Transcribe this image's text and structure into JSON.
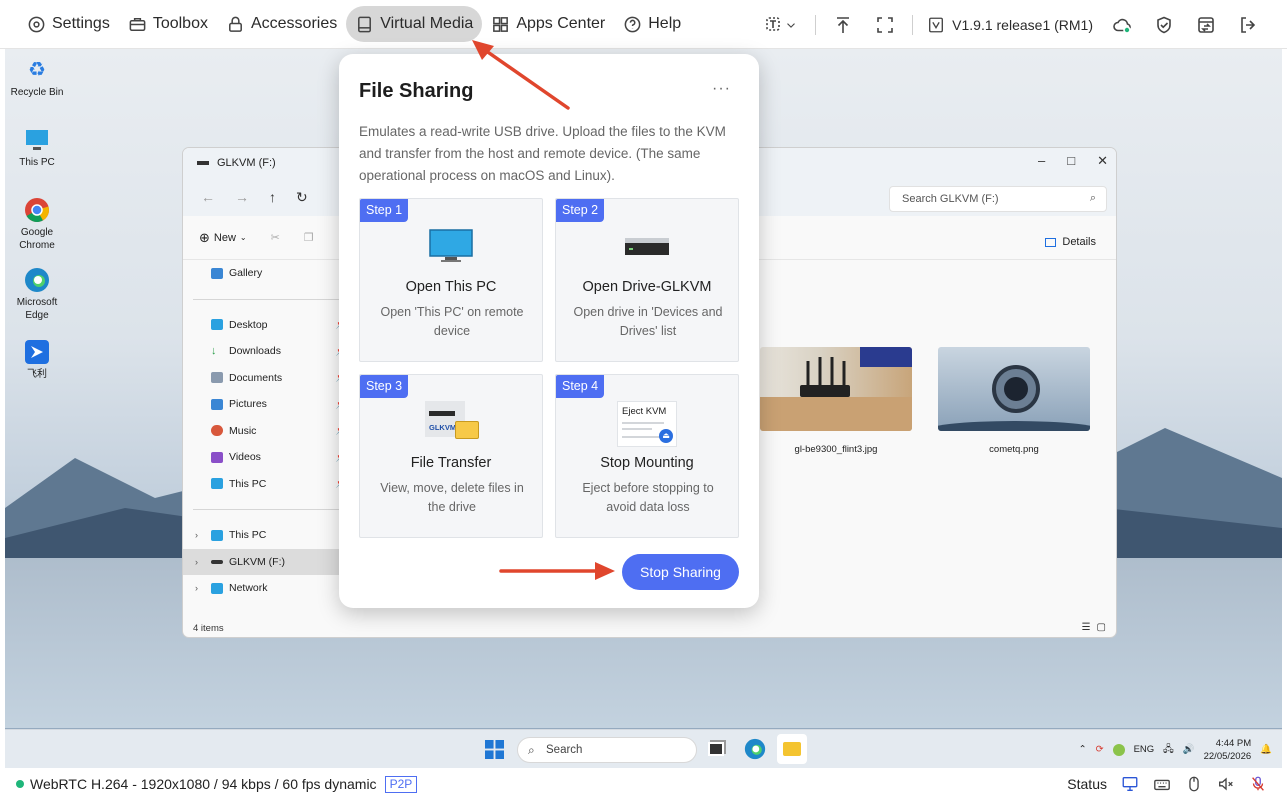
{
  "topbar": {
    "settings": "Settings",
    "toolbox": "Toolbox",
    "accessories": "Accessories",
    "virtual_media": "Virtual Media",
    "apps_center": "Apps Center",
    "help": "Help",
    "version": "V1.9.1 release1 (RM1)"
  },
  "desktop": {
    "icons": [
      "Recycle Bin",
      "This PC",
      "Google Chrome",
      "Microsoft Edge",
      "飞利"
    ]
  },
  "explorer": {
    "tab_title": "GLKVM (F:)",
    "search_placeholder": "Search GLKVM (F:)",
    "new_label": "New",
    "details_label": "Details",
    "sidebar": [
      "Gallery",
      "Desktop",
      "Downloads",
      "Documents",
      "Pictures",
      "Music",
      "Videos",
      "This PC"
    ],
    "tree": [
      "This PC",
      "GLKVM (F:)",
      "Network"
    ],
    "status": "4 items",
    "files": [
      "gl-be9300_flint3.jpg",
      "cometq.png"
    ]
  },
  "taskbar": {
    "search": "Search",
    "lang": "ENG",
    "time": "4:44 PM",
    "date": "22/05/2026"
  },
  "popup": {
    "title": "File Sharing",
    "more": "···",
    "description": "Emulates a read-write USB drive. Upload the files to the KVM and transfer from the host and remote device. (The same operational process on macOS and Linux).",
    "steps": [
      {
        "badge": "Step 1",
        "title": "Open This PC",
        "sub": "Open 'This PC' on remote device"
      },
      {
        "badge": "Step 2",
        "title": "Open Drive-GLKVM",
        "sub": "Open drive in 'Devices and Drives' list"
      },
      {
        "badge": "Step 3",
        "title": "File Transfer",
        "sub": "View, move, delete files in the drive",
        "img_label": "GLKVM"
      },
      {
        "badge": "Step 4",
        "title": "Stop Mounting",
        "sub": "Eject before stopping to avoid data loss",
        "img_label": "Eject KVM"
      }
    ],
    "stop_button": "Stop Sharing"
  },
  "status": {
    "stream": "WebRTC H.264 - 1920x1080 / 94 kbps / 60 fps dynamic",
    "p2p": "P2P",
    "status_label": "Status"
  }
}
